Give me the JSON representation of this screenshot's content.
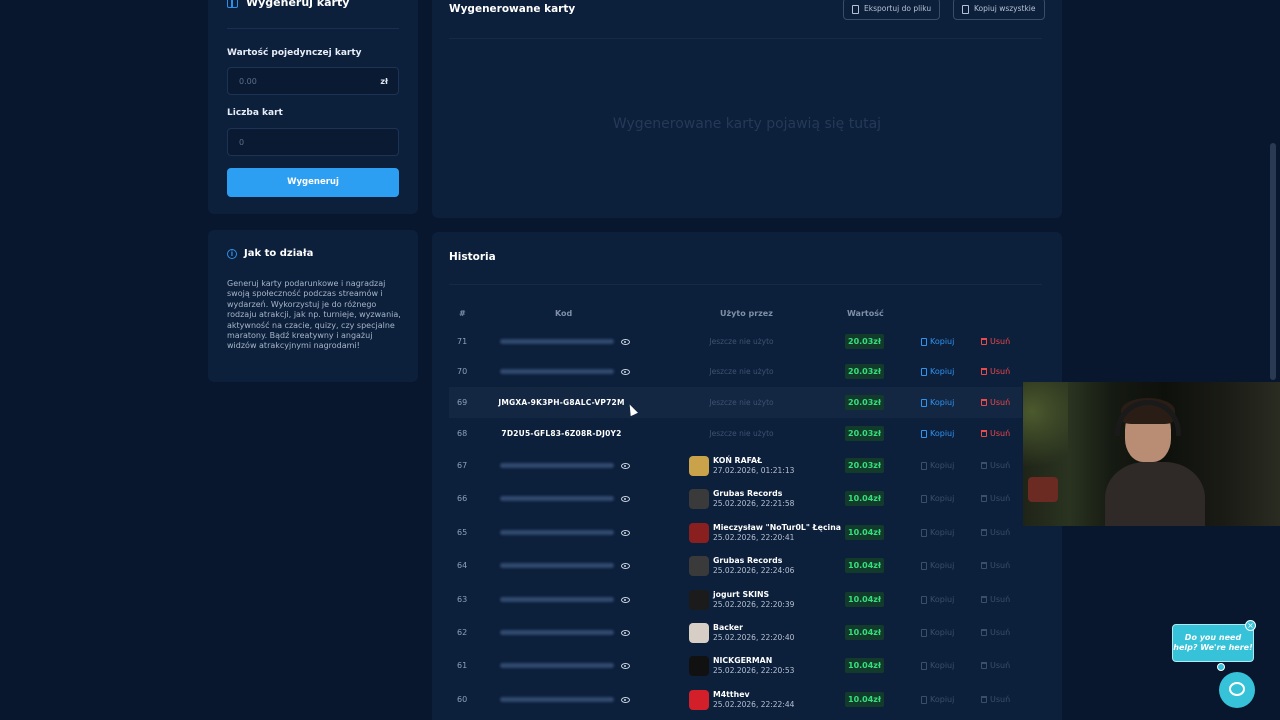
{
  "generate": {
    "title": "Wygeneruj karty",
    "value_label": "Wartość pojedynczej karty",
    "value_placeholder": "0.00",
    "currency": "zł",
    "count_label": "Liczba kart",
    "count_placeholder": "0",
    "button": "Wygeneruj"
  },
  "info": {
    "title": "Jak to działa",
    "text": "Generuj karty podarunkowe i nagradzaj swoją społeczność podczas streamów i wydarzeń. Wykorzystuj je do różnego rodzaju atrakcji, jak np. turnieje, wyzwania, aktywność na czacie, quizy, czy specjalne maratony. Bądź kreatywny i angażuj widzów atrakcyjnymi nagrodami!"
  },
  "generated": {
    "title": "Wygenerowane karty",
    "export_button": "Eksportuj do pliku",
    "copy_all_button": "Kopiuj wszystkie",
    "empty": "Wygenerowane karty pojawią się tutaj"
  },
  "history": {
    "title": "Historia",
    "headers": {
      "num": "#",
      "code": "Kod",
      "used_by": "Użyto przez",
      "value": "Wartość"
    },
    "copy_label": "Kopiuj",
    "delete_label": "Usuń",
    "rows": [
      {
        "num": "71",
        "code": null,
        "used_by": "Jeszcze nie użyto",
        "user": null,
        "date": null,
        "value": "20.03zł",
        "avatar_color": null
      },
      {
        "num": "70",
        "code": null,
        "used_by": "Jeszcze nie użyto",
        "user": null,
        "date": null,
        "value": "20.03zł",
        "avatar_color": null
      },
      {
        "num": "69",
        "code": "JMGXA-9K3PH-G8ALC-VP72M",
        "used_by": "Jeszcze nie użyto",
        "user": null,
        "date": null,
        "value": "20.03zł",
        "avatar_color": null
      },
      {
        "num": "68",
        "code": "7D2U5-GFL83-6Z08R-DJ0Y2",
        "used_by": "Jeszcze nie użyto",
        "user": null,
        "date": null,
        "value": "20.03zł",
        "avatar_color": null
      },
      {
        "num": "67",
        "code": null,
        "used_by": null,
        "user": "KOŃ RAFAŁ",
        "date": "27.02.2026, 01:21:13",
        "value": "20.03zł",
        "avatar_color": "#c9a24a"
      },
      {
        "num": "66",
        "code": null,
        "used_by": null,
        "user": "Grubas Records",
        "date": "25.02.2026, 22:21:58",
        "value": "10.04zł",
        "avatar_color": "#3a3a3a"
      },
      {
        "num": "65",
        "code": null,
        "used_by": null,
        "user": "Mieczysław \"NoTur0L\" Łęcina",
        "date": "25.02.2026, 22:20:41",
        "value": "10.04zł",
        "avatar_color": "#8a1f1f"
      },
      {
        "num": "64",
        "code": null,
        "used_by": null,
        "user": "Grubas Records",
        "date": "25.02.2026, 22:24:06",
        "value": "10.04zł",
        "avatar_color": "#3a3a3a"
      },
      {
        "num": "63",
        "code": null,
        "used_by": null,
        "user": "jogurt SKINS",
        "date": "25.02.2026, 22:20:39",
        "value": "10.04zł",
        "avatar_color": "#1b1b1b"
      },
      {
        "num": "62",
        "code": null,
        "used_by": null,
        "user": "Backer",
        "date": "25.02.2026, 22:20:40",
        "value": "10.04zł",
        "avatar_color": "#d7cfc6"
      },
      {
        "num": "61",
        "code": null,
        "used_by": null,
        "user": "NICKGERMAN",
        "date": "25.02.2026, 22:20:53",
        "value": "10.04zł",
        "avatar_color": "#111111"
      },
      {
        "num": "60",
        "code": null,
        "used_by": null,
        "user": "M4tthev",
        "date": "25.02.2026, 22:22:44",
        "value": "10.04zł",
        "avatar_color": "#d21f2a"
      }
    ]
  },
  "help": {
    "bubble_text": "Do you need help? We're here!",
    "close": "×"
  },
  "colors": {
    "accent": "#2c9ff3",
    "success": "#35e07b",
    "danger": "#ef4848",
    "help": "#36c3d9"
  }
}
